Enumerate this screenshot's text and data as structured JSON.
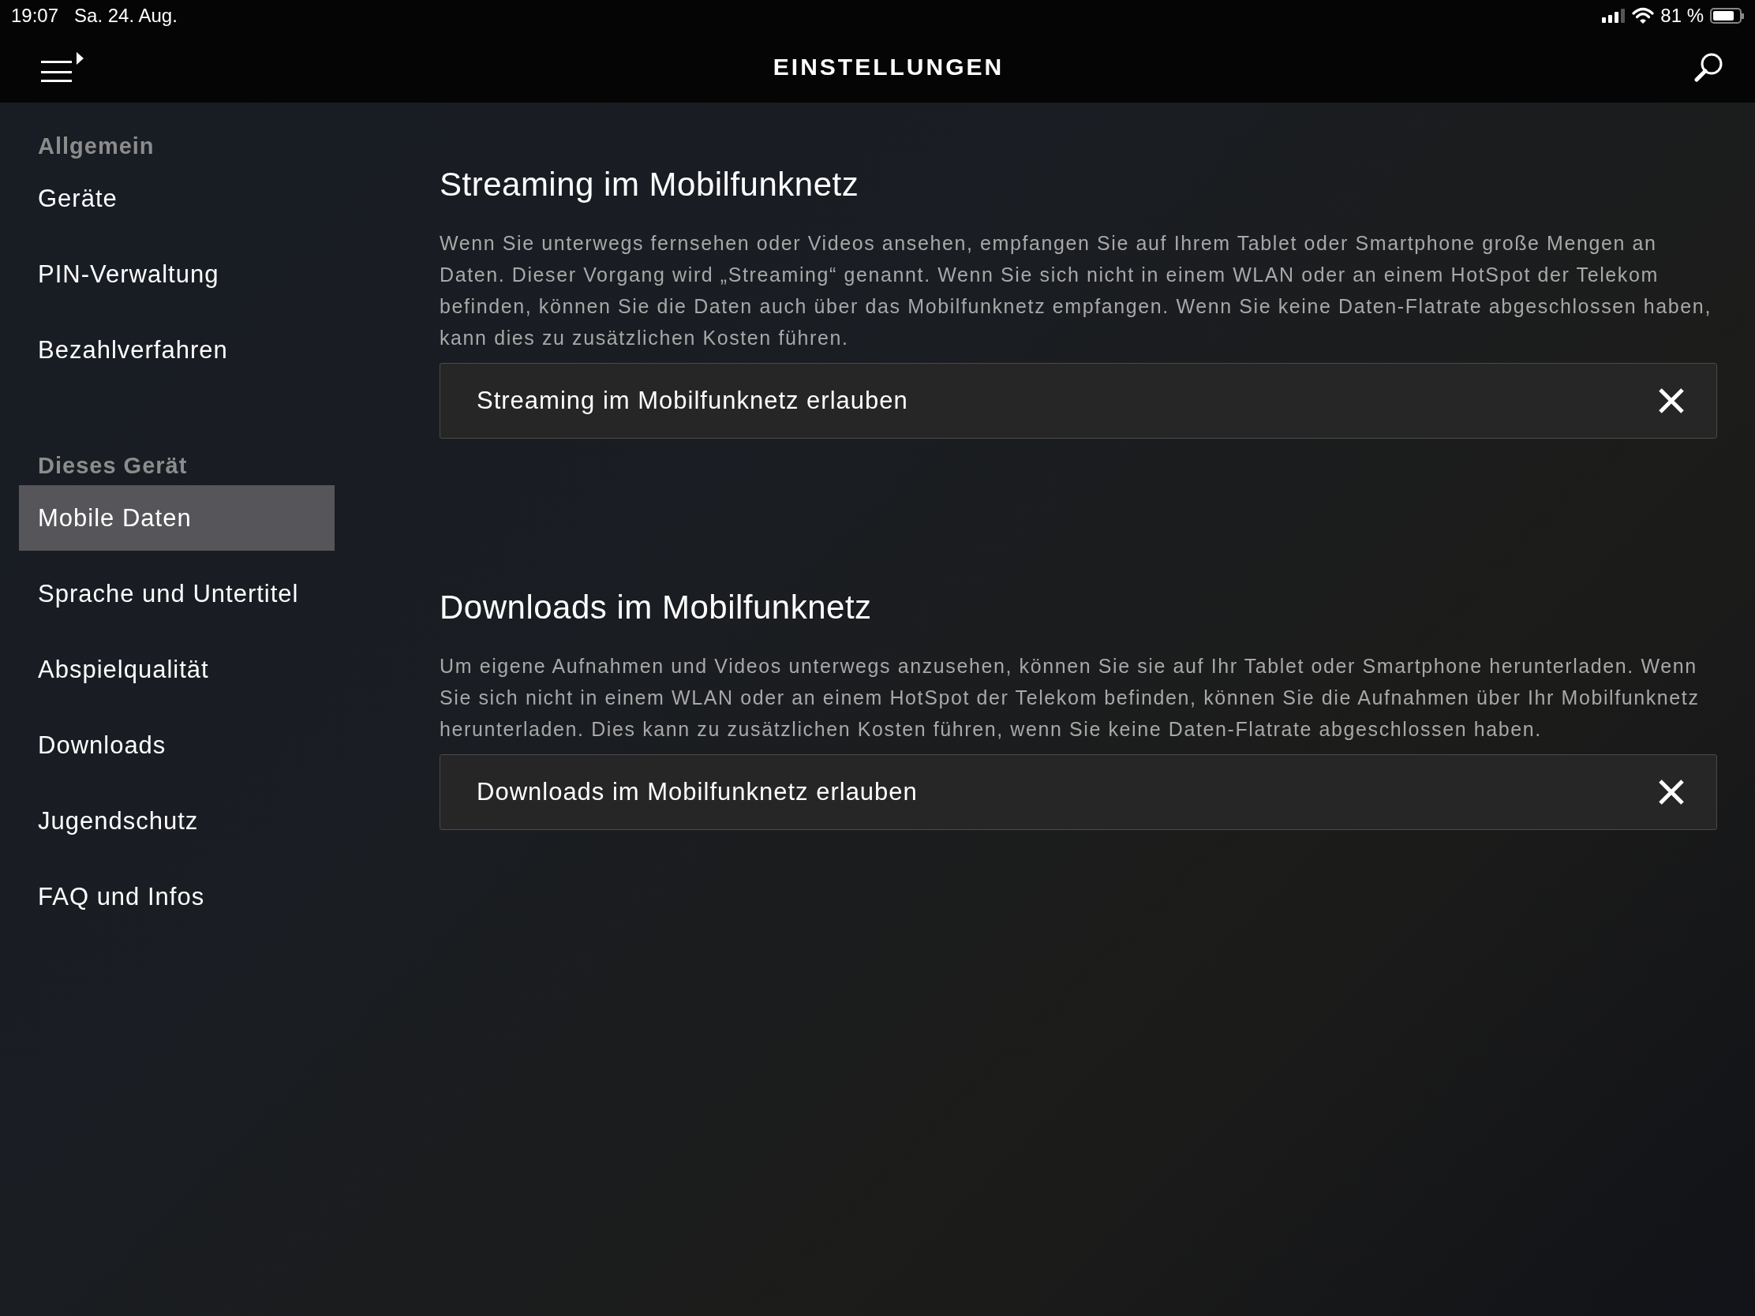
{
  "status_bar": {
    "time": "19:07",
    "date": "Sa. 24. Aug.",
    "battery_text": "81 %"
  },
  "header": {
    "title": "EINSTELLUNGEN"
  },
  "sidebar": {
    "sections": [
      {
        "title": "Allgemein",
        "items": [
          {
            "label": "Geräte",
            "selected": false
          },
          {
            "label": "PIN-Verwaltung",
            "selected": false
          },
          {
            "label": "Bezahlverfahren",
            "selected": false
          }
        ]
      },
      {
        "title": "Dieses Gerät",
        "items": [
          {
            "label": "Mobile Daten",
            "selected": true
          },
          {
            "label": "Sprache und Untertitel",
            "selected": false
          },
          {
            "label": "Abspielqualität",
            "selected": false
          },
          {
            "label": "Downloads",
            "selected": false
          },
          {
            "label": "Jugendschutz",
            "selected": false
          },
          {
            "label": "FAQ und Infos",
            "selected": false
          }
        ]
      }
    ]
  },
  "settings": [
    {
      "heading": "Streaming im Mobilfunknetz",
      "description": "Wenn Sie unterwegs fernsehen oder Videos ansehen, empfangen Sie auf Ihrem Tablet oder Smartphone große Mengen an Daten. Dieser Vorgang wird „Streaming“ genannt. Wenn Sie sich nicht in einem WLAN oder an einem HotSpot der Telekom befinden, können Sie die Daten auch über das Mobilfunknetz empfangen. Wenn Sie keine Daten-Flatrate abgeschlossen haben, kann dies zu zusätzlichen Kosten führen.",
      "toggle_label": "Streaming im Mobilfunknetz erlauben",
      "on": false
    },
    {
      "heading": "Downloads im Mobilfunknetz",
      "description": "Um eigene Aufnahmen und Videos unterwegs anzusehen, können Sie sie auf Ihr Tablet oder Smartphone herunterladen. Wenn Sie sich nicht in einem WLAN oder an einem HotSpot der Telekom befinden, können Sie die Aufnahmen über Ihr Mobilfunknetz herunterladen. Dies kann zu zusätzlichen Kosten führen, wenn Sie keine Daten-Flatrate abgeschlossen haben.",
      "toggle_label": "Downloads im Mobilfunknetz erlauben",
      "on": false
    }
  ]
}
